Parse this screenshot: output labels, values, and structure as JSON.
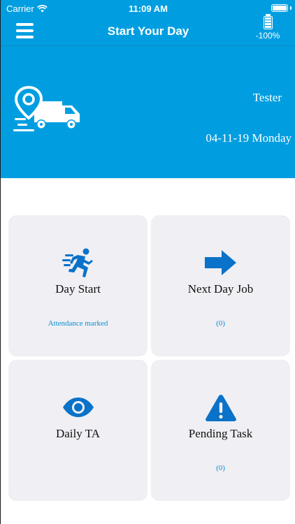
{
  "status_bar": {
    "carrier": "Carrier",
    "time": "11:09 AM",
    "wifi_icon": "wifi-icon",
    "battery_icon": "battery-icon"
  },
  "nav": {
    "title": "Start Your Day",
    "menu_icon": "hamburger-menu-icon",
    "battery_icon": "battery-level-icon",
    "battery_label": "-100%"
  },
  "banner": {
    "logo_icon": "delivery-truck-location-icon",
    "user_name": "Tester",
    "date": "04-11-19 Monday"
  },
  "tiles": [
    {
      "icon": "running-man-icon",
      "label": "Day Start",
      "status": "Attendance marked"
    },
    {
      "icon": "arrow-right-icon",
      "label": "Next Day Job",
      "status": "(0)"
    },
    {
      "icon": "eye-icon",
      "label": "Daily TA",
      "status": ""
    },
    {
      "icon": "warning-triangle-icon",
      "label": "Pending Task",
      "status": "(0)"
    }
  ],
  "colors": {
    "brand": "#009ee0",
    "icon": "#0a72c8",
    "tile_bg": "#efeff4",
    "status_text": "#0a8fd1"
  }
}
